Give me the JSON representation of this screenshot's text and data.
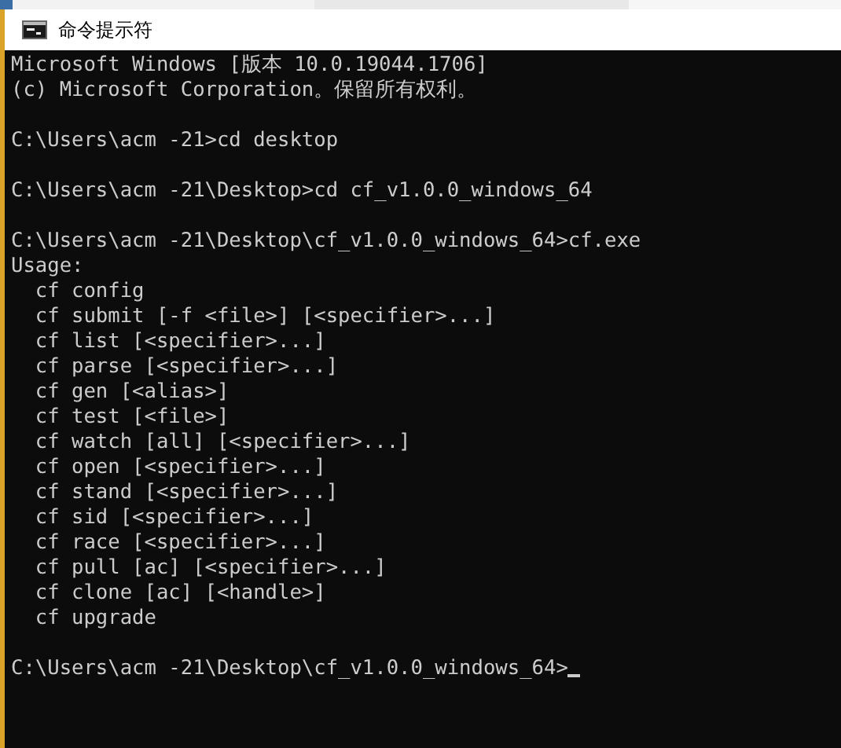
{
  "window": {
    "title": "命令提示符"
  },
  "console": {
    "cursor": true,
    "blocks": [
      [
        "Microsoft Windows [版本 10.0.19044.1706]",
        "(c) Microsoft Corporation。保留所有权利。"
      ],
      [
        "C:\\Users\\acm -21>cd desktop"
      ],
      [
        "C:\\Users\\acm -21\\Desktop>cd cf_v1.0.0_windows_64"
      ],
      [
        "C:\\Users\\acm -21\\Desktop\\cf_v1.0.0_windows_64>cf.exe",
        "Usage:",
        "  cf config",
        "  cf submit [-f <file>] [<specifier>...]",
        "  cf list [<specifier>...]",
        "  cf parse [<specifier>...]",
        "  cf gen [<alias>]",
        "  cf test [<file>]",
        "  cf watch [all] [<specifier>...]",
        "  cf open [<specifier>...]",
        "  cf stand [<specifier>...]",
        "  cf sid [<specifier>...]",
        "  cf race [<specifier>...]",
        "  cf pull [ac] [<specifier>...]",
        "  cf clone [ac] [<handle>]",
        "  cf upgrade"
      ],
      [
        "C:\\Users\\acm -21\\Desktop\\cf_v1.0.0_windows_64>"
      ]
    ]
  }
}
